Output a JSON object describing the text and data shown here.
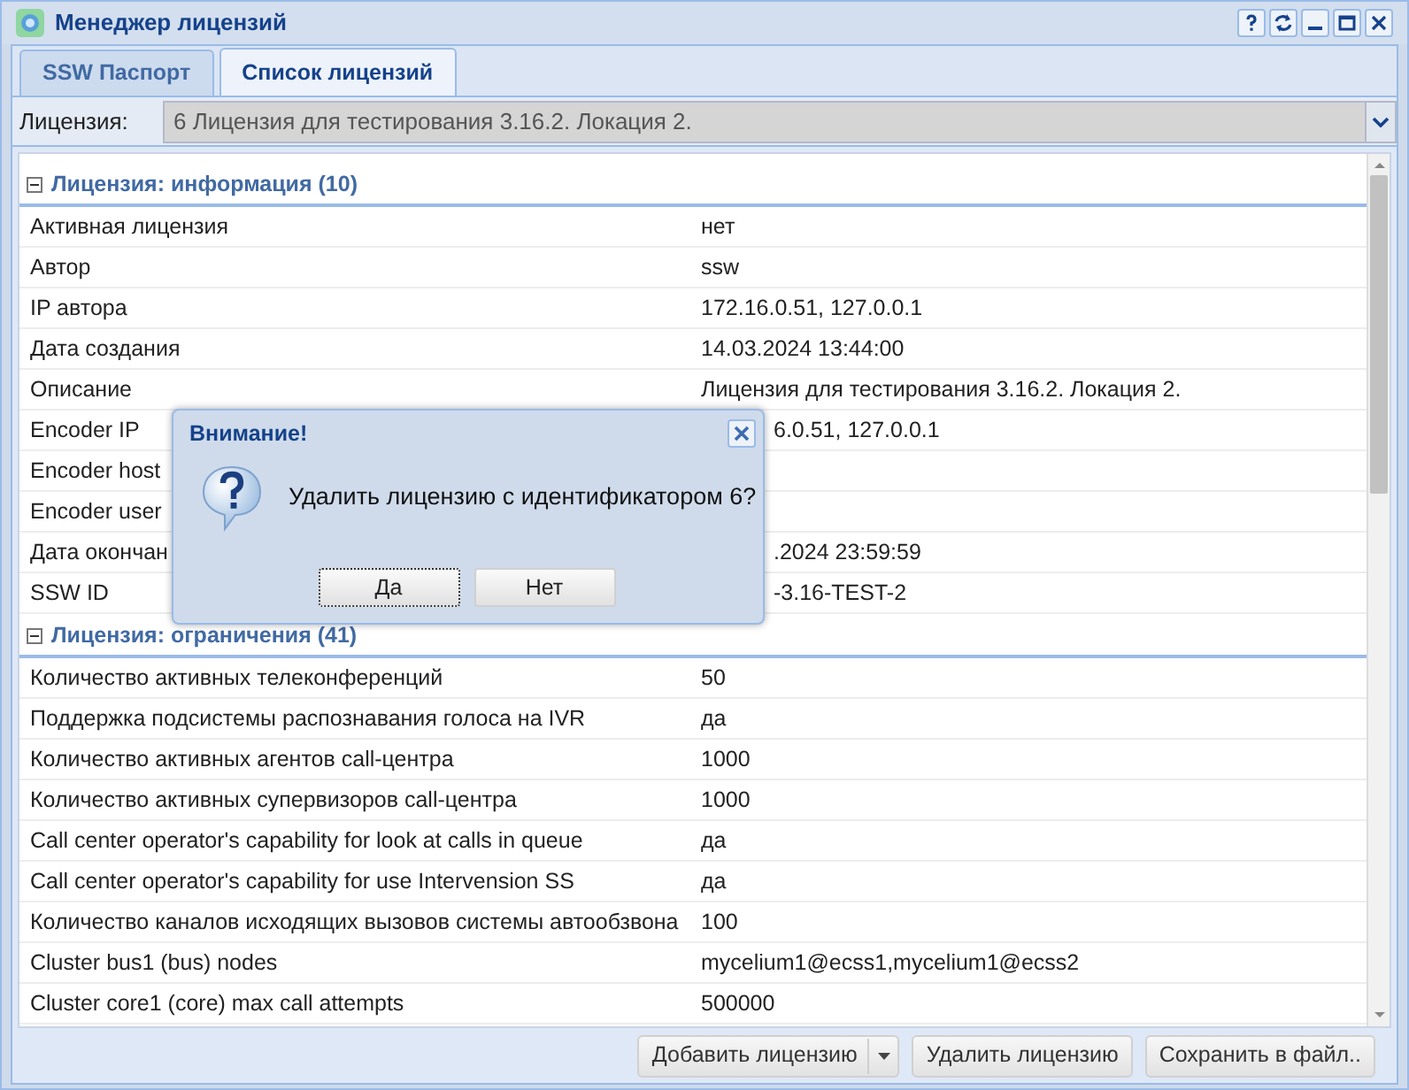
{
  "window": {
    "title": "Менеджер лицензий"
  },
  "tabs": [
    {
      "label": "SSW Паспорт",
      "selected": false
    },
    {
      "label": "Список лицензий",
      "selected": true
    }
  ],
  "license_select": {
    "label": "Лицензия:",
    "value": "6 Лицензия для тестирования 3.16.2. Локация 2."
  },
  "sections": [
    {
      "title": "Лицензия: информация (10)",
      "expanded": true,
      "rows": [
        {
          "label": "Активная лицензия",
          "value": "нет"
        },
        {
          "label": "Автор",
          "value": "ssw"
        },
        {
          "label": "IP автора",
          "value": "172.16.0.51, 127.0.0.1"
        },
        {
          "label": "Дата создания",
          "value": "14.03.2024 13:44:00"
        },
        {
          "label": "Описание",
          "value": "Лицензия для тестирования 3.16.2. Локация 2."
        },
        {
          "label": "Encoder IP",
          "value": "6.0.51, 127.0.0.1",
          "kind": "partial"
        },
        {
          "label": "Encoder host"
        },
        {
          "label": "Encoder user"
        },
        {
          "label": "Дата окончан",
          "value": ".2024 23:59:59",
          "kind": "partial"
        },
        {
          "label": "SSW ID",
          "value": "-3.16-TEST-2",
          "kind": "partial"
        }
      ]
    },
    {
      "title": "Лицензия: ограничения (41)",
      "expanded": true,
      "rows": [
        {
          "label": "Количество активных телеконференций",
          "value": "50"
        },
        {
          "label": "Поддержка подсистемы распознавания голоса на IVR",
          "value": "да"
        },
        {
          "label": "Количество активных агентов call-центра",
          "value": "1000"
        },
        {
          "label": "Количество активных супервизоров call-центра",
          "value": "1000"
        },
        {
          "label": "Call center operator's capability for look at calls in queue",
          "value": "да"
        },
        {
          "label": "Call center operator's capability for use Intervension SS",
          "value": "да"
        },
        {
          "label": "Количество каналов исходящих вызовов системы автообзвона",
          "value": "100"
        },
        {
          "label": "Cluster bus1 (bus) nodes",
          "value": "mycelium1@ecss1,mycelium1@ecss2"
        },
        {
          "label": "Cluster core1 (core) max call attempts",
          "value": "500000"
        }
      ]
    }
  ],
  "toolbar": [
    {
      "label": "Добавить лицензию",
      "kind": "split"
    },
    {
      "label": "Удалить лицензию",
      "kind": "plain"
    },
    {
      "label": "Сохранить в файл..",
      "kind": "plain"
    }
  ],
  "dialog": {
    "title": "Внимание!",
    "message": "Удалить лицензию с идентификатором 6?",
    "buttons": [
      {
        "label": "Да",
        "selected": true
      },
      {
        "label": "Нет",
        "selected": false
      }
    ]
  }
}
